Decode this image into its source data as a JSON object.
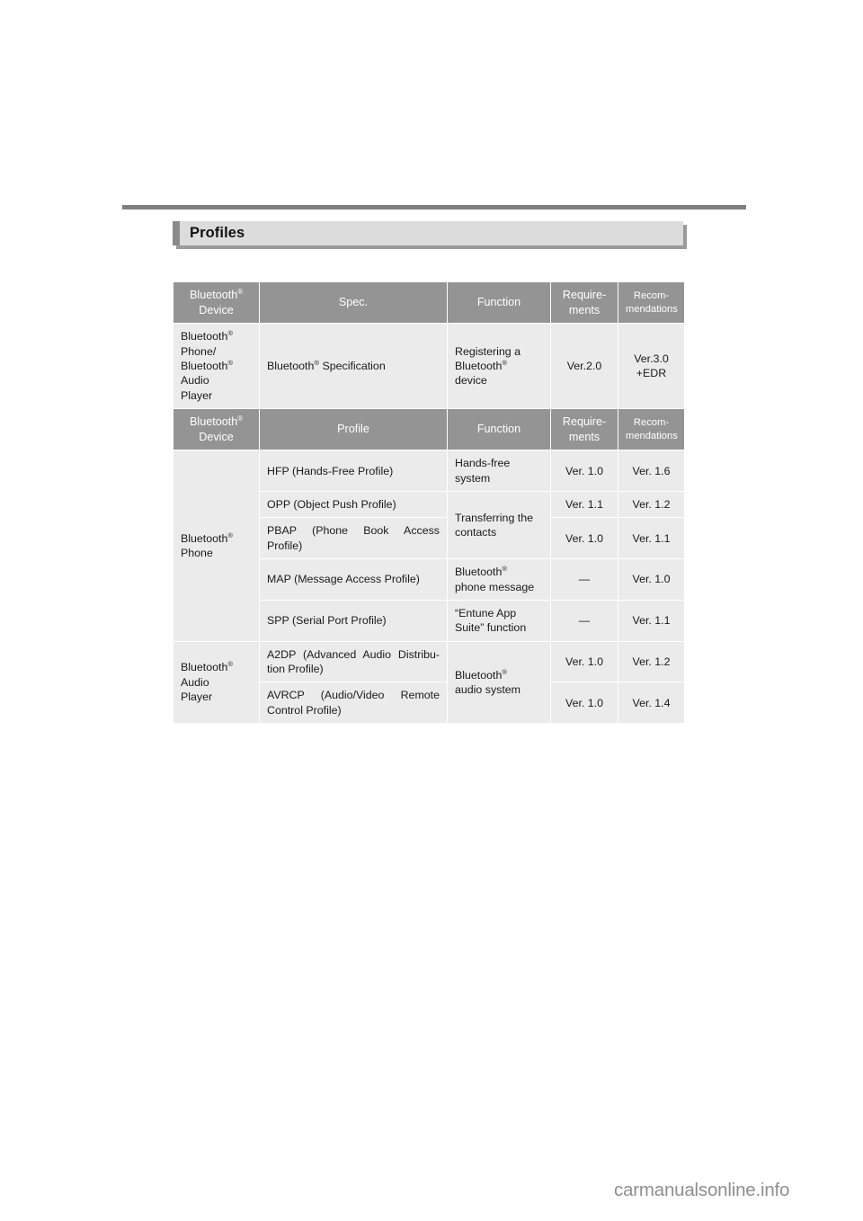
{
  "page": {
    "section_title": "Profiles",
    "watermark": "carmanualsonline.info"
  },
  "spec_table": {
    "headers": {
      "device": "Bluetooth<sup>®</sup><br>Device",
      "spec": "Spec.",
      "function": "Function",
      "requirements": "Require-<br>ments",
      "recommendations": "Recom-<br>mendations"
    },
    "rows": [
      {
        "device": "Bluetooth<sup>®</sup><br>Phone/<br>Bluetooth<sup>®</sup><br>Audio<br>Player",
        "spec": "Bluetooth<sup>®</sup> Specification",
        "function": "Registering a<br>Bluetooth<sup>®</sup><br>device",
        "requirements": "Ver.2.0",
        "recommendations": "Ver.3.0<br>+EDR"
      }
    ]
  },
  "profile_table": {
    "headers": {
      "device": "Bluetooth<sup>®</sup><br>Device",
      "profile": "Profile",
      "function": "Function",
      "requirements": "Require-<br>ments",
      "recommendations": "Recom-<br>mendations"
    },
    "device_groups": [
      {
        "label": "Bluetooth<sup>®</sup><br>Phone",
        "rowspan": 5
      },
      {
        "label": "Bluetooth<sup>®</sup><br>Audio<br>Player",
        "rowspan": 2
      }
    ],
    "rows": [
      {
        "profile": "HFP (Hands-Free Profile)",
        "function": "Hands-free<br>system",
        "function_rowspan": 1,
        "requirements": "Ver. 1.0",
        "recommendations": "Ver. 1.6"
      },
      {
        "profile": "OPP (Object Push Profile)",
        "function": "Transferring the<br>contacts",
        "function_rowspan": 2,
        "requirements": "Ver. 1.1",
        "recommendations": "Ver. 1.2"
      },
      {
        "profile": "PBAP (Phone Book Access Profile)",
        "function": null,
        "function_rowspan": 0,
        "requirements": "Ver. 1.0",
        "recommendations": "Ver. 1.1"
      },
      {
        "profile": "MAP (Message Access Profile)",
        "function": "Bluetooth<sup>®</sup><br>phone message",
        "function_rowspan": 1,
        "requirements": "—",
        "recommendations": "Ver. 1.0"
      },
      {
        "profile": "SPP (Serial Port Profile)",
        "function": "“Entune App<br>Suite” function",
        "function_rowspan": 1,
        "requirements": "—",
        "recommendations": "Ver. 1.1"
      },
      {
        "profile": "A2DP (Advanced Audio Distribu-tion Profile)",
        "function": "Bluetooth<sup>®</sup><br>audio system",
        "function_rowspan": 2,
        "requirements": "Ver. 1.0",
        "recommendations": "Ver. 1.2"
      },
      {
        "profile": "AVRCP (Audio/Video Remote Control Profile)",
        "function": null,
        "function_rowspan": 0,
        "requirements": "Ver. 1.0",
        "recommendations": "Ver. 1.4"
      }
    ]
  }
}
